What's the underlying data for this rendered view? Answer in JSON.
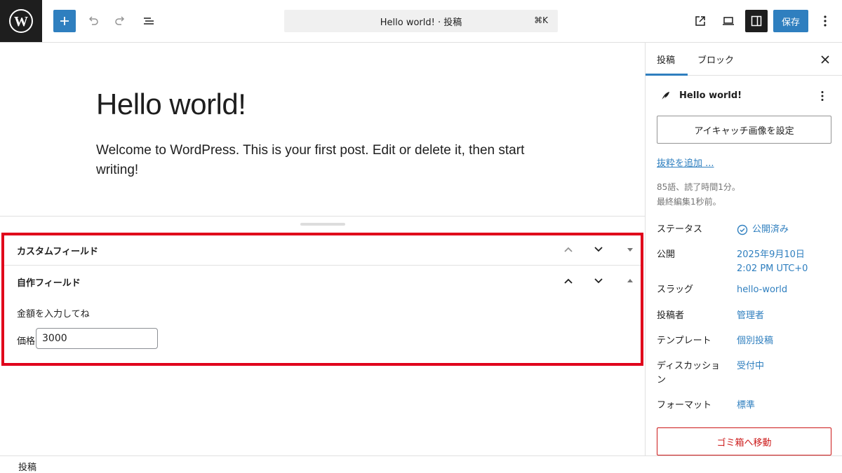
{
  "toolbar": {
    "save_label": "保存",
    "command_bar": {
      "title": "Hello world! · 投稿",
      "shortcut": "⌘K"
    },
    "icons": [
      "wordpress-logo-icon",
      "plus-icon",
      "undo-icon",
      "redo-icon",
      "list-view-icon",
      "external-link-icon",
      "desktop-preview-icon",
      "sidebar-toggle-icon",
      "more-vertical-icon"
    ]
  },
  "post": {
    "title": "Hello world!",
    "body": "Welcome to WordPress. This is your first post. Edit or delete it, then start writing!"
  },
  "meta_boxes": {
    "custom_fields": {
      "title": "カスタムフィールド"
    },
    "own_fields": {
      "title": "自作フィールド",
      "description": "金額を入力してね",
      "price_label": "価格",
      "price_value": "3000"
    }
  },
  "sidebar": {
    "tabs": [
      "投稿",
      "ブロック"
    ],
    "post_title": "Hello world!",
    "featured_image_button": "アイキャッチ画像を設定",
    "excerpt_link": "抜粋を追加 ...",
    "stats": {
      "words": "85語、読了時間1分。",
      "edited": "最終編集1秒前。"
    },
    "rows": [
      {
        "label": "ステータス",
        "value": "公開済み"
      },
      {
        "label": "公開",
        "value": "2025年9月10日",
        "value2": "2:02 PM UTC+0"
      },
      {
        "label": "スラッグ",
        "value": "hello-world"
      },
      {
        "label": "投稿者",
        "value": "管理者"
      },
      {
        "label": "テンプレート",
        "value": "個別投稿"
      },
      {
        "label": "ディスカッション",
        "value": "受付中"
      },
      {
        "label": "フォーマット",
        "value": "標準"
      }
    ],
    "trash_button": "ゴミ箱へ移動"
  },
  "footer": {
    "breadcrumb": "投稿"
  }
}
